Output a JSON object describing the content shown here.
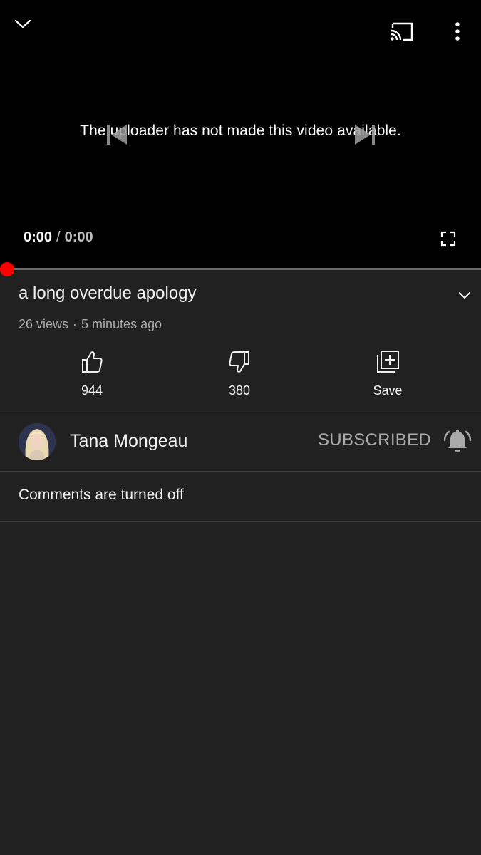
{
  "player": {
    "message": "The uploader has not made this video available.",
    "current_time": "0:00",
    "separator": "/",
    "duration": "0:00",
    "progress": 0,
    "icons": {
      "collapse": "chevron-down-icon",
      "cast": "cast-icon",
      "more": "more-vert-icon",
      "previous": "skip-previous-icon",
      "next": "skip-next-icon",
      "fullscreen": "fullscreen-icon"
    },
    "accent_color": "#ff0000"
  },
  "video": {
    "title": "a long overdue apology",
    "views": "26 views",
    "meta_separator": "·",
    "published": "5 minutes ago"
  },
  "actions": {
    "like_count": "944",
    "dislike_count": "380",
    "save_label": "Save"
  },
  "channel": {
    "name": "Tana Mongeau",
    "subscribe_label": "SUBSCRIBED"
  },
  "comments": {
    "status": "Comments are turned off"
  }
}
